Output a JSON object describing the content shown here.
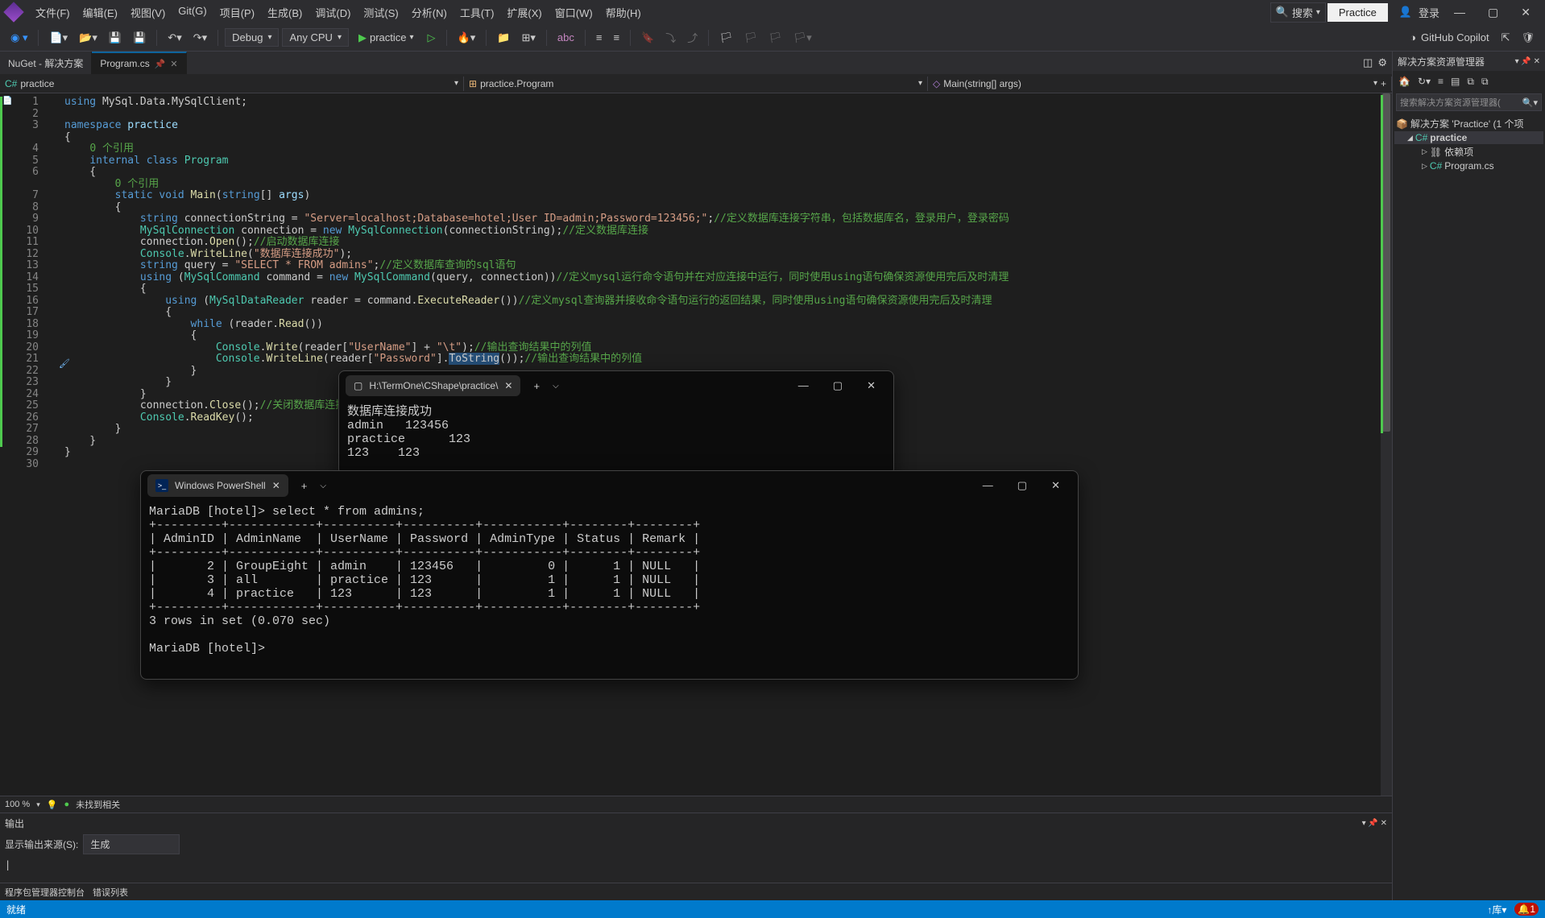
{
  "menubar": {
    "items": [
      "文件(F)",
      "编辑(E)",
      "视图(V)",
      "Git(G)",
      "项目(P)",
      "生成(B)",
      "调试(D)",
      "测试(S)",
      "分析(N)",
      "工具(T)",
      "扩展(X)",
      "窗口(W)",
      "帮助(H)"
    ],
    "search": "搜索",
    "practiceBtn": "Practice",
    "login": "登录"
  },
  "toolbar": {
    "configCombo": "Debug",
    "platformCombo": "Any CPU",
    "runLabel": "practice",
    "copilot": "GitHub Copilot"
  },
  "tabs": {
    "items": [
      {
        "label": "NuGet - 解决方案",
        "active": false
      },
      {
        "label": "Program.cs",
        "active": true
      }
    ]
  },
  "crumbs": {
    "project": "practice",
    "namespace": "practice.Program",
    "method": "Main(string[] args)"
  },
  "code": {
    "referencesText": "0 个引用",
    "lines": 30
  },
  "outputPanel": {
    "title": "输出",
    "sourceLabel": "显示输出来源(S):",
    "sourceValue": "生成",
    "bottomTabs": [
      "程序包管理器控制台",
      "错误列表"
    ],
    "zoom": "100 %",
    "issues": "未找到相关"
  },
  "solution": {
    "title": "解决方案资源管理器",
    "searchPlaceholder": "搜索解决方案资源管理器(",
    "root": "解决方案 'Practice' (1 个项",
    "project": "practice",
    "depNode": "依赖项",
    "file": "Program.cs"
  },
  "statusbar": {
    "ready": "就绪"
  },
  "termWin": {
    "tabTitle": "H:\\TermOne\\CShape\\practice\\",
    "lines": [
      "数据库连接成功",
      "admin   123456",
      "practice      123",
      "123    123"
    ]
  },
  "psWin": {
    "tabTitle": "Windows PowerShell",
    "content": "MariaDB [hotel]> select * from admins;\n+---------+------------+----------+----------+-----------+--------+--------+\n| AdminID | AdminName  | UserName | Password | AdminType | Status | Remark |\n+---------+------------+----------+----------+-----------+--------+--------+\n|       2 | GroupEight | admin    | 123456   |         0 |      1 | NULL   |\n|       3 | all        | practice | 123      |         1 |      1 | NULL   |\n|       4 | practice   | 123      | 123      |         1 |      1 | NULL   |\n+---------+------------+----------+----------+-----------+--------+--------+\n3 rows in set (0.070 sec)\n\nMariaDB [hotel]> "
  }
}
